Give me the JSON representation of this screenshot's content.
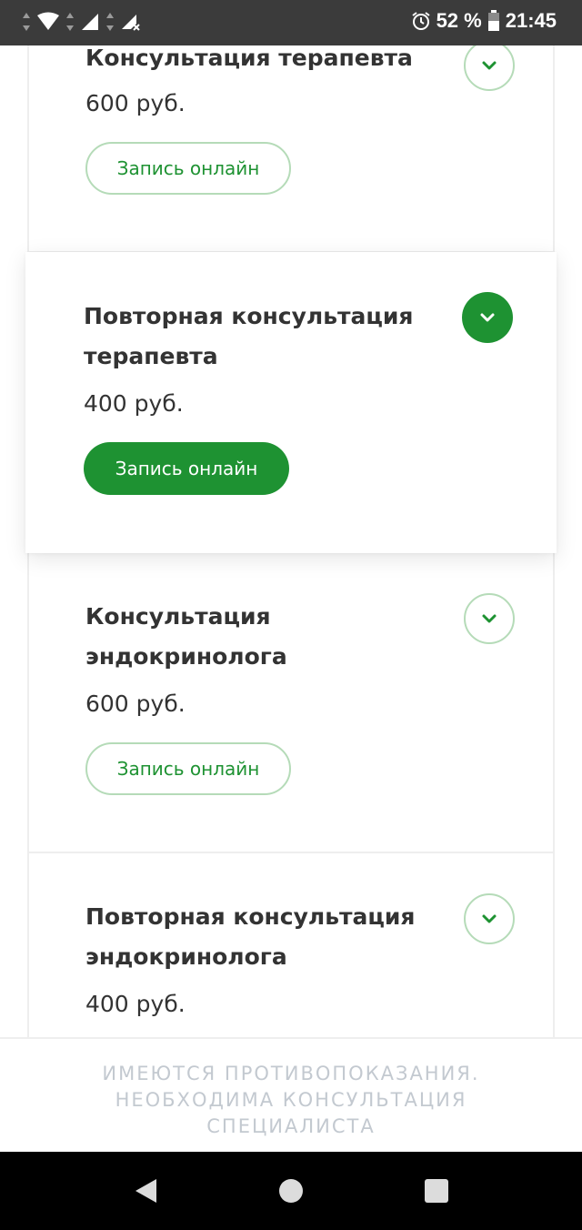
{
  "status_bar": {
    "battery": "52 %",
    "time": "21:45"
  },
  "services": [
    {
      "title": "Консультация терапевта",
      "price": "600 руб.",
      "button_label": "Запись онлайн",
      "expanded": false
    },
    {
      "title": "Повторная консультация терапевта",
      "price": "400 руб.",
      "button_label": "Запись онлайн",
      "expanded": true
    },
    {
      "title": "Консультация эндокринолога",
      "price": "600 руб.",
      "button_label": "Запись онлайн",
      "expanded": false
    },
    {
      "title": "Повторная консультация эндокринолога",
      "price": "400 руб.",
      "expanded": false
    }
  ],
  "disclaimer": {
    "text": "ИМЕЮТСЯ ПРОТИВОПОКАЗАНИЯ. НЕОБХОДИМА КОНСУЛЬТАЦИЯ СПЕЦИАЛИСТА"
  },
  "colors": {
    "accent": "#1e9232",
    "accent_light_border": "#b5dbb8",
    "disclaimer_text": "#c3c9d0",
    "status_bar": "#3b3b3b"
  },
  "icons": {
    "toggle": "chevron-down-icon",
    "nav_back": "back-triangle-icon",
    "nav_home": "home-circle-icon",
    "nav_recents": "recents-square-icon"
  }
}
